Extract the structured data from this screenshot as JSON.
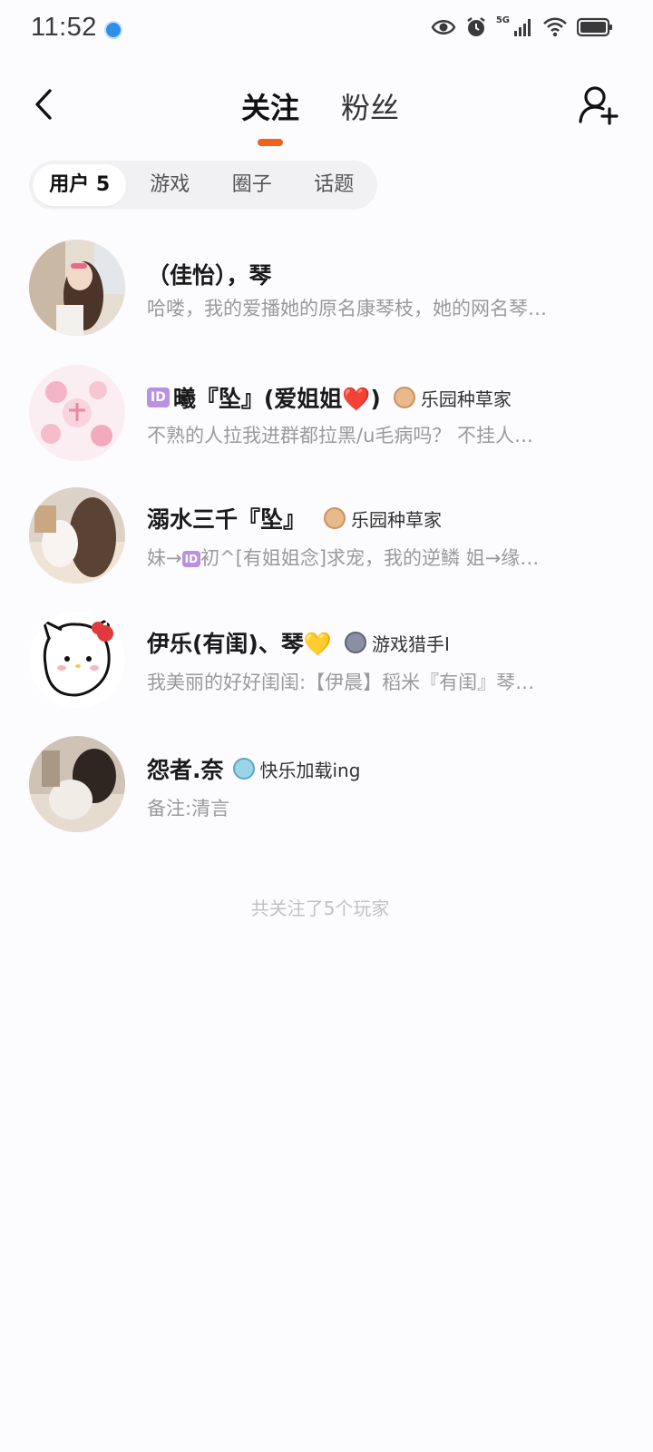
{
  "status_bar": {
    "time": "11:52",
    "network": "5G"
  },
  "header": {
    "tabs": [
      {
        "label": "关注",
        "active": true
      },
      {
        "label": "粉丝",
        "active": false
      }
    ],
    "accent_color": "#f0631c"
  },
  "segments": [
    {
      "label": "用户 5",
      "active": true
    },
    {
      "label": "游戏",
      "active": false
    },
    {
      "label": "圈子",
      "active": false
    },
    {
      "label": "话题",
      "active": false
    }
  ],
  "users": [
    {
      "name": "（佳怡），琴",
      "badge": "",
      "desc": "哈喽，我的爱播她的原名康琴枝，她的网名琴…"
    },
    {
      "name_tag": "ID",
      "name": "曦『坠』(爱姐姐❤️)",
      "badge": "乐园种草家",
      "desc": "不熟的人拉我进群都拉黑/u毛病吗？ 不挂人…"
    },
    {
      "name": "溺水三千『坠』",
      "badge": "乐园种草家",
      "desc_prefix": "妹→",
      "desc_tag": "ID",
      "desc": "初^[有姐姐念]求宠，我的逆鳞 姐→缘…"
    },
    {
      "name": "伊乐(有闺)、琴💛",
      "badge": "游戏猎手I",
      "desc": "我美丽的好好闺闺:【伊晨】稻米『有闺』琴…"
    },
    {
      "name": "怨者.奈",
      "badge": "快乐加载ing",
      "desc": "备注:清言"
    }
  ],
  "footer": "共关注了5个玩家"
}
